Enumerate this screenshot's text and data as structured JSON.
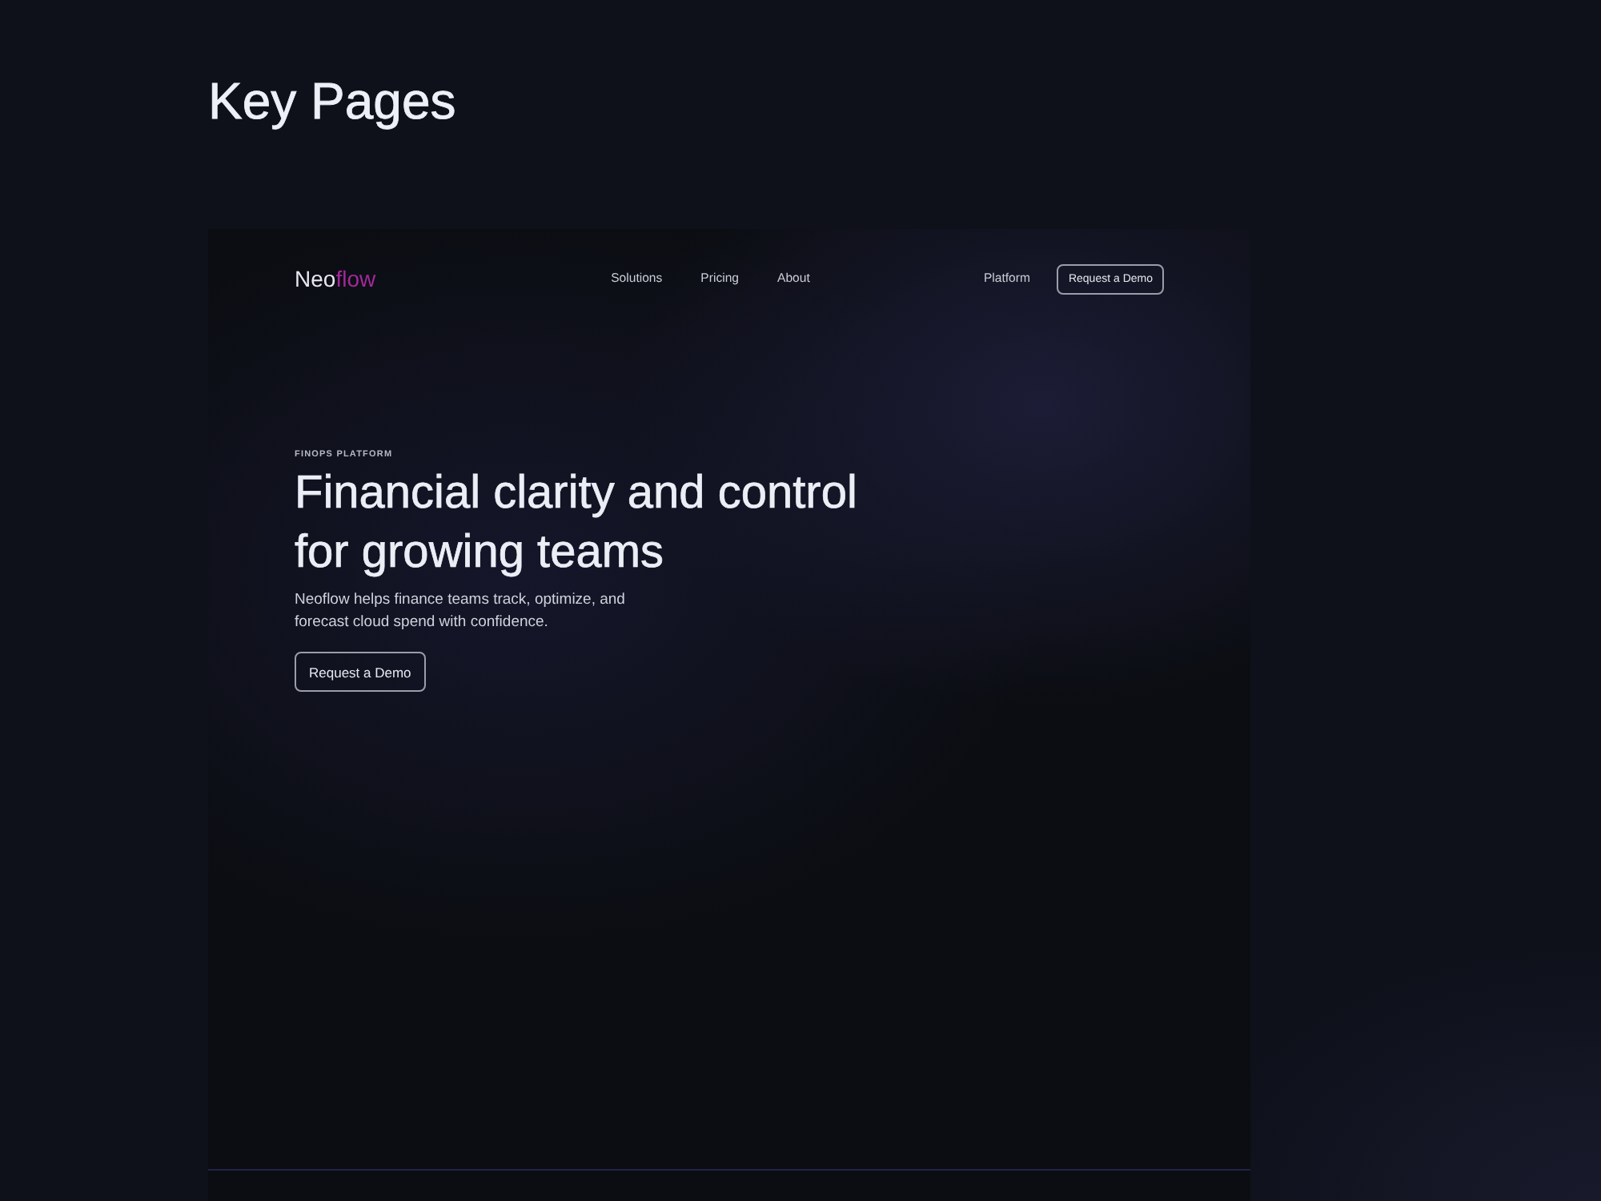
{
  "page": {
    "title": "Key Pages"
  },
  "preview": {
    "nav": {
      "logo": {
        "segments": [
          {
            "text": "Neo"
          },
          {
            "text": "flow"
          }
        ]
      },
      "links": [
        {
          "label": "Solutions"
        },
        {
          "label": "Pricing"
        },
        {
          "label": "About"
        }
      ],
      "secondary_link": "Platform",
      "cta": "Request a Demo"
    },
    "hero": {
      "eyebrow": "FINOPS PLATFORM",
      "heading": "Financial clarity and control for growing teams",
      "body": "Neoflow helps finance teams track, optimize, and forecast cloud spend with confidence.",
      "button": "Request a Demo"
    }
  }
}
